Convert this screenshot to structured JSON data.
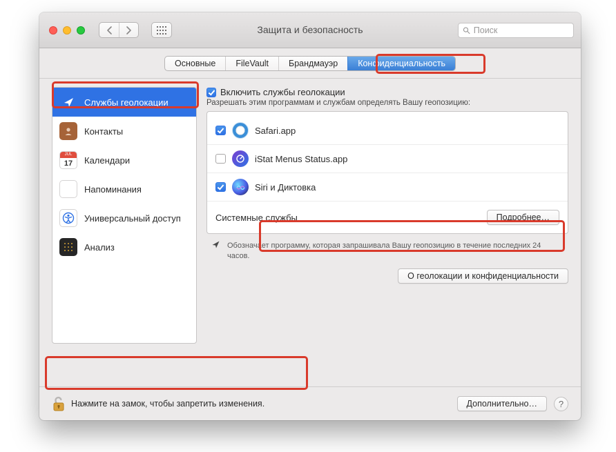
{
  "window": {
    "title": "Защита и безопасность"
  },
  "search": {
    "placeholder": "Поиск"
  },
  "tabs": [
    {
      "label": "Основные",
      "active": false
    },
    {
      "label": "FileVault",
      "active": false
    },
    {
      "label": "Брандмауэр",
      "active": false
    },
    {
      "label": "Конфиденциальность",
      "active": true
    }
  ],
  "sidebar": {
    "items": [
      {
        "label": "Службы геолокации",
        "selected": true
      },
      {
        "label": "Контакты"
      },
      {
        "label": "Календари",
        "day": "17",
        "month": "JUL"
      },
      {
        "label": "Напоминания"
      },
      {
        "label": "Универсальный доступ"
      },
      {
        "label": "Анализ"
      }
    ]
  },
  "main": {
    "enable_label": "Включить службы геолокации",
    "enable_checked": true,
    "sub_label": "Разрешать этим программам и службам определять Вашу геопозицию:",
    "apps": [
      {
        "name": "Safari.app",
        "checked": true,
        "icon": "safari"
      },
      {
        "name": "iStat Menus Status.app",
        "checked": false,
        "icon": "istat"
      },
      {
        "name": "Siri и Диктовка",
        "checked": true,
        "icon": "siri"
      }
    ],
    "system_services_label": "Системные службы",
    "details_button": "Подробнее…",
    "hint": "Обозначает программу, которая запрашивала Вашу геопозицию в течение последних 24 часов.",
    "about_button": "О геолокации и конфиденциальности"
  },
  "footer": {
    "lock_text": "Нажмите на замок, чтобы запретить изменения.",
    "advanced_button": "Дополнительно…"
  }
}
